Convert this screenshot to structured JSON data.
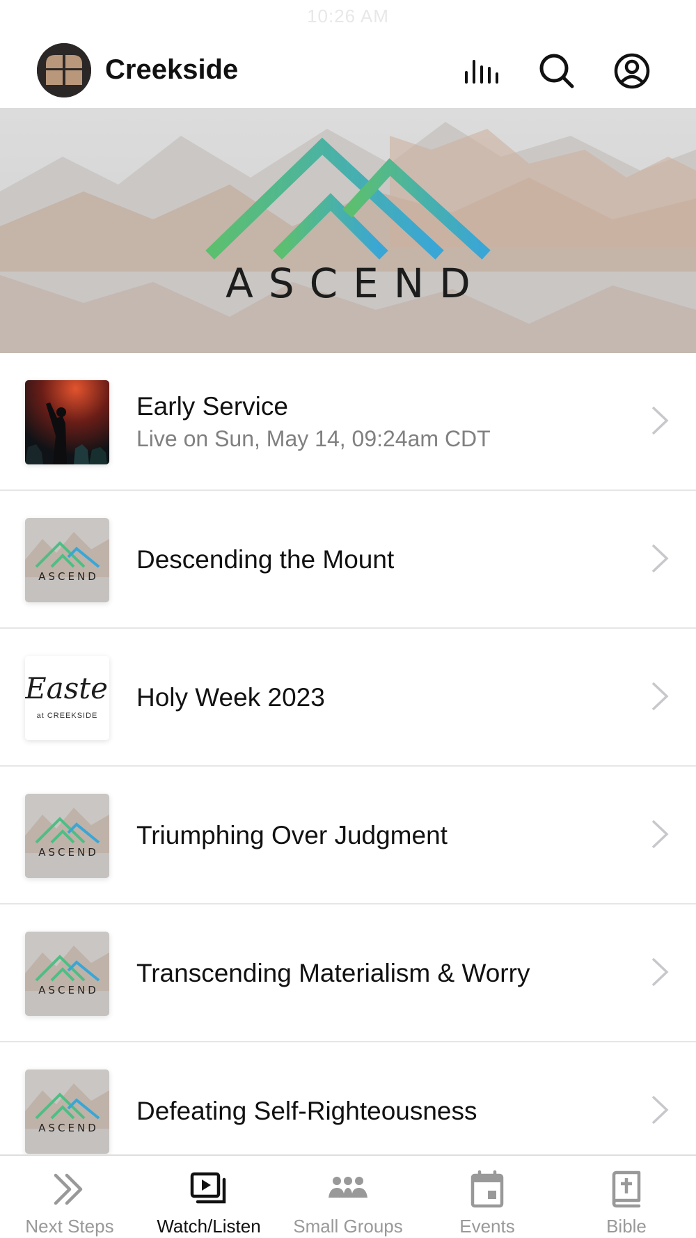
{
  "status_bar": {
    "time": "10:26 AM"
  },
  "header": {
    "title": "Creekside",
    "icons": [
      "bars-icon",
      "search-icon",
      "account-icon"
    ]
  },
  "hero": {
    "word": "ASCEND"
  },
  "items": [
    {
      "title": "Early Service",
      "subtitle": "Live on Sun, May 14, 09:24am CDT",
      "thumb": "concert"
    },
    {
      "title": "Descending the Mount",
      "thumb": "ascend",
      "thumb_word": "ASCEND"
    },
    {
      "title": "Holy Week 2023",
      "thumb": "easter",
      "thumb_script": "Easter",
      "thumb_sub": "at CREEKSIDE"
    },
    {
      "title": "Triumphing Over Judgment",
      "thumb": "ascend",
      "thumb_word": "ASCEND"
    },
    {
      "title": "Transcending Materialism & Worry",
      "thumb": "ascend",
      "thumb_word": "ASCEND"
    },
    {
      "title": "Defeating Self-Righteousness",
      "thumb": "ascend",
      "thumb_word": "ASCEND"
    }
  ],
  "tabs": [
    {
      "label": "Next Steps",
      "icon": "double-chevron-icon",
      "active": false
    },
    {
      "label": "Watch/Listen",
      "icon": "play-stack-icon",
      "active": true
    },
    {
      "label": "Small Groups",
      "icon": "group-icon",
      "active": false
    },
    {
      "label": "Events",
      "icon": "calendar-icon",
      "active": false
    },
    {
      "label": "Bible",
      "icon": "bible-icon",
      "active": false
    }
  ],
  "colors": {
    "logo_green": "#5cbf6f",
    "logo_blue": "#3aa6d6",
    "text_primary": "#111111",
    "text_secondary": "#808080",
    "tab_inactive": "#999999"
  }
}
